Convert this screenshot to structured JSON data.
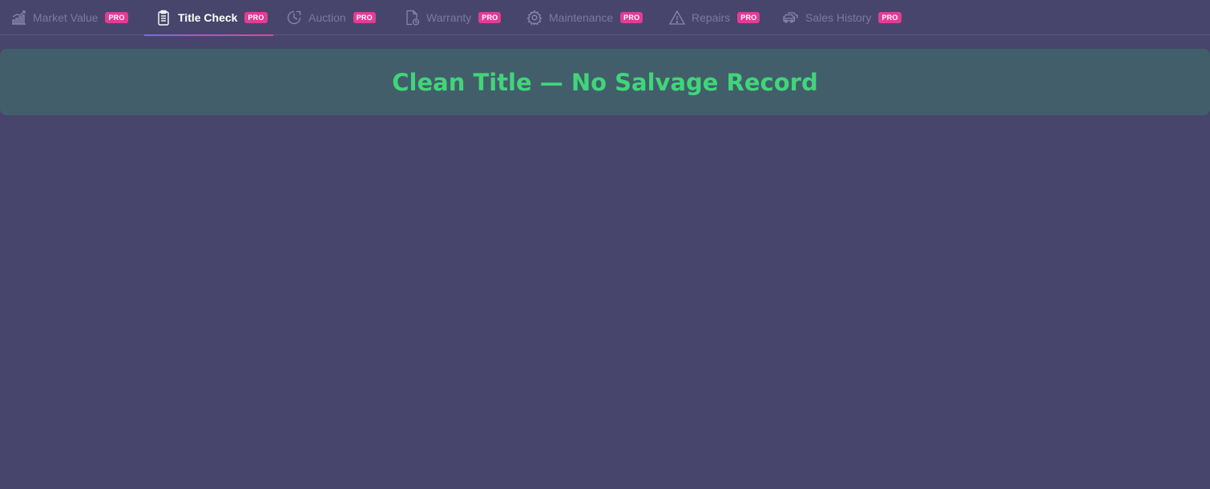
{
  "tabs": [
    {
      "label": "Market Value",
      "badge": "PRO",
      "icon": "chart-bar-icon",
      "active": false
    },
    {
      "label": "Title Check",
      "badge": "PRO",
      "icon": "clipboard-icon",
      "active": true
    },
    {
      "label": "Auction",
      "badge": "PRO",
      "icon": "clock-icon",
      "active": false
    },
    {
      "label": "Warranty",
      "badge": "PRO",
      "icon": "document-clock-icon",
      "active": false
    },
    {
      "label": "Maintenance",
      "badge": "PRO",
      "icon": "gear-icon",
      "active": false
    },
    {
      "label": "Repairs",
      "badge": "PRO",
      "icon": "warning-icon",
      "active": false
    },
    {
      "label": "Sales History",
      "badge": "PRO",
      "icon": "cars-icon",
      "active": false
    }
  ],
  "status": {
    "text": "Clean Title — No Salvage Record",
    "color": "#41d57a"
  },
  "colors": {
    "background": "#47456b",
    "card": "#425e6b",
    "badge": "#e23c96"
  }
}
